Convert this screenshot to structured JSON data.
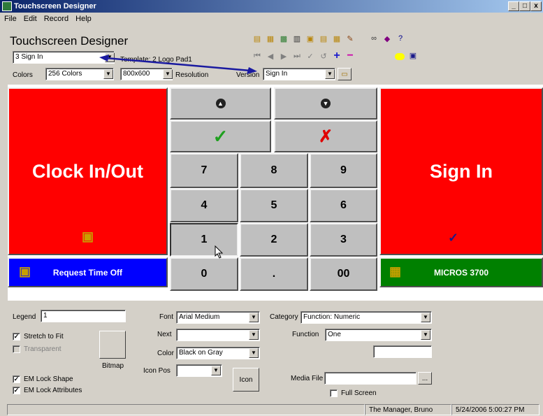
{
  "window": {
    "title": "Touchscreen Designer",
    "minimize": "_",
    "maximize": "□",
    "close": "x"
  },
  "menu": [
    "File",
    "Edit",
    "Record",
    "Help"
  ],
  "header": {
    "app_title": "Touchscreen Designer",
    "screen_select": "3 Sign In",
    "template_label": "Template: 2 Logo Pad1",
    "colors_label": "Colors",
    "colors_value": "256 Colors",
    "resolution_value": "800x600",
    "resolution_label": "Resolution",
    "version_label": "Version",
    "version_value": "Sign In"
  },
  "keys": {
    "clock_in_out": "Clock In/Out",
    "sign_in": "Sign In",
    "request_time_off": "Request Time Off",
    "micros": "MICROS 3700",
    "n7": "7",
    "n8": "8",
    "n9": "9",
    "n4": "4",
    "n5": "5",
    "n6": "6",
    "n1": "1",
    "n2": "2",
    "n3": "3",
    "n0": "0",
    "dot": ".",
    "n00": "00"
  },
  "colors": {
    "red": "#ff0000",
    "blue": "#0000ff",
    "green": "#008000",
    "key_gray": "#bfbfbf"
  },
  "props": {
    "legend_label": "Legend",
    "legend_value": "1",
    "stretch_label": "Stretch to Fit",
    "transparent_label": "Transparent",
    "bitmap_label": "Bitmap",
    "em_shape_label": "EM Lock Shape",
    "em_attr_label": "EM Lock Attributes",
    "font_label": "Font",
    "font_value": "Arial Medium",
    "next_label": "Next",
    "next_value": "",
    "color_label": "Color",
    "color_value": "Black on Gray",
    "iconpos_label": "Icon Pos",
    "iconpos_value": "",
    "icon_button": "Icon",
    "category_label": "Category",
    "category_value": "Function: Numeric",
    "function_label": "Function",
    "function_value": "One",
    "mediafile_label": "Media File",
    "mediafile_value": "",
    "browse_button": "...",
    "fullscreen_label": "Full Screen"
  },
  "status": {
    "user": "The Manager, Bruno",
    "datetime": "5/24/2006 5:00:27 PM"
  }
}
